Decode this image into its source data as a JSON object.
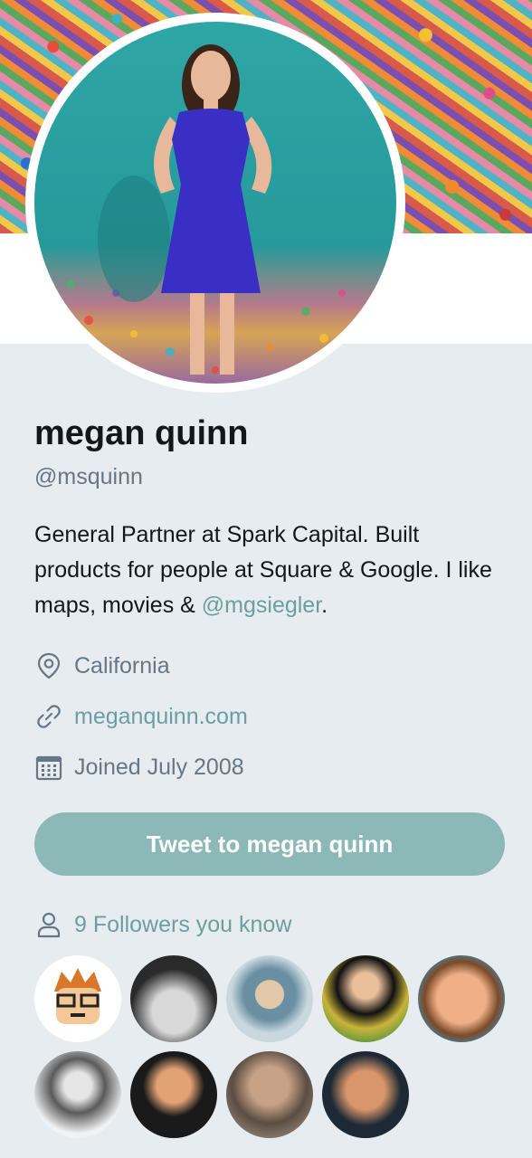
{
  "profile": {
    "name": "megan quinn",
    "handle": "@msquinn",
    "bio_text": "General Partner at Spark Capital. Built products for people at Square & Google. I like maps, movies & ",
    "bio_mention": "@mgsiegler",
    "bio_end": ".",
    "location": "California",
    "website": "meganquinn.com",
    "joined": "Joined July 2008"
  },
  "actions": {
    "tweet_button": "Tweet to megan quinn"
  },
  "followers": {
    "label": "9 Followers you know",
    "count": 9
  },
  "colors": {
    "accent": "#6b9ea3",
    "button": "#8db8b8",
    "background": "#e6ecf0",
    "secondary_text": "#657786"
  }
}
